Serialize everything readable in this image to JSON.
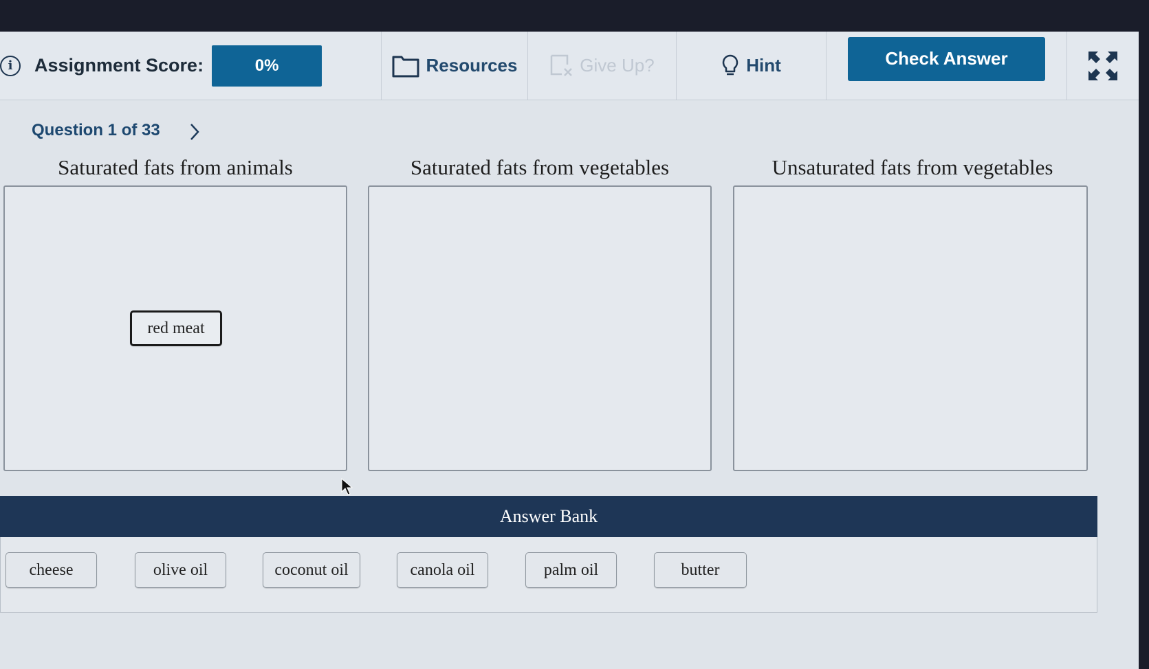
{
  "toolbar": {
    "score_label": "Assignment Score:",
    "score_value": "0%",
    "resources_label": "Resources",
    "give_up_label": "Give Up?",
    "hint_label": "Hint",
    "check_answer_label": "Check Answer"
  },
  "question_nav": {
    "label": "Question 1 of 33"
  },
  "categories": [
    {
      "title": "Saturated fats from animals",
      "items": [
        "red meat"
      ]
    },
    {
      "title": "Saturated fats from vegetables",
      "items": []
    },
    {
      "title": "Unsaturated fats from vegetables",
      "items": []
    }
  ],
  "answer_bank": {
    "title": "Answer Bank",
    "items": [
      "cheese",
      "olive oil",
      "coconut oil",
      "canola oil",
      "palm oil",
      "butter"
    ]
  },
  "colors": {
    "primary": "#0f6496",
    "bank_header": "#1e3656",
    "link": "#234a6e"
  },
  "icons": {
    "info": "info-icon",
    "resources": "folder-icon",
    "give_up": "give-up-icon",
    "hint": "lightbulb-icon",
    "expand": "fullscreen-icon",
    "next": "chevron-right-icon"
  }
}
